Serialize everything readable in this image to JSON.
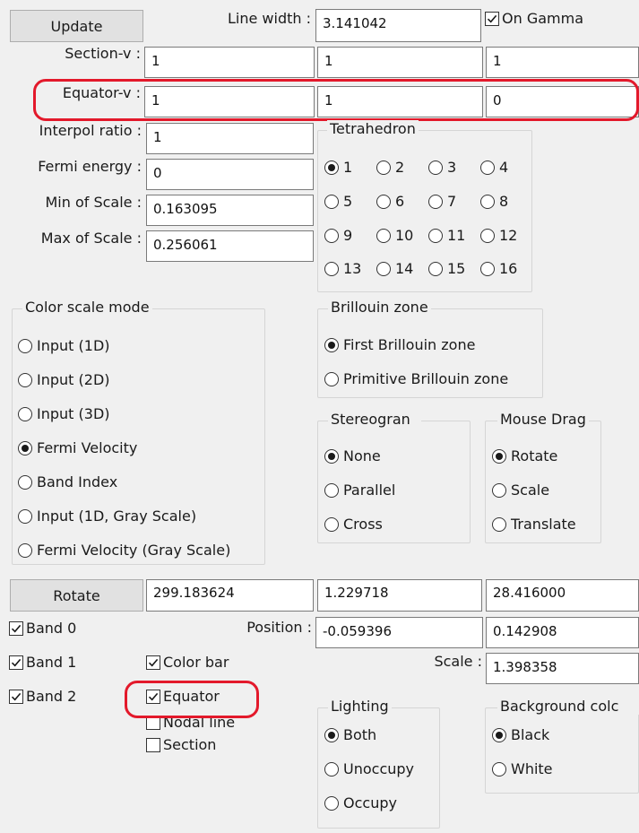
{
  "top": {
    "update_label": "Update",
    "line_width_label": "Line width :",
    "line_width_value": "3.141042",
    "on_gamma_label": "On Gamma",
    "on_gamma_checked": true
  },
  "vectors": {
    "section_label": "Section-v :",
    "section_values": [
      "1",
      "1",
      "1"
    ],
    "equator_label": "Equator-v :",
    "equator_values": [
      "1",
      "1",
      "0"
    ]
  },
  "params": {
    "interpol_label": "Interpol ratio :",
    "interpol_value": "1",
    "fermi_label": "Fermi energy :",
    "fermi_value": "0",
    "min_label": "Min of Scale :",
    "min_value": "0.163095",
    "max_label": "Max of Scale :",
    "max_value": "0.256061"
  },
  "tetrahedron": {
    "title": "Tetrahedron",
    "options": [
      "1",
      "2",
      "3",
      "4",
      "5",
      "6",
      "7",
      "8",
      "9",
      "10",
      "11",
      "12",
      "13",
      "14",
      "15",
      "16"
    ],
    "selected": "1"
  },
  "color_scale": {
    "title": "Color scale mode",
    "options": [
      "Input (1D)",
      "Input (2D)",
      "Input (3D)",
      "Fermi Velocity",
      "Band Index",
      "Input (1D, Gray Scale)",
      "Fermi Velocity (Gray Scale)"
    ],
    "selected": "Fermi Velocity"
  },
  "brillouin": {
    "title": "Brillouin zone",
    "options": [
      "First Brillouin zone",
      "Primitive Brillouin zone"
    ],
    "selected": "First Brillouin zone"
  },
  "stereogram": {
    "title": "Stereogran",
    "options": [
      "None",
      "Parallel",
      "Cross"
    ],
    "selected": "None"
  },
  "mouse_drag": {
    "title": "Mouse Drag",
    "options": [
      "Rotate",
      "Scale",
      "Translate"
    ],
    "selected": "Rotate"
  },
  "rotate": {
    "button_label": "Rotate",
    "values": [
      "299.183624",
      "1.229718",
      "28.416000"
    ]
  },
  "position": {
    "label": "Position :",
    "values": [
      "-0.059396",
      "0.142908"
    ]
  },
  "scale": {
    "label": "Scale :",
    "value": "1.398358"
  },
  "bands": [
    {
      "label": "Band 0",
      "checked": true
    },
    {
      "label": "Band 1",
      "checked": true
    },
    {
      "label": "Band 2",
      "checked": true
    }
  ],
  "display_checks": [
    {
      "label": "Color bar",
      "checked": true
    },
    {
      "label": "Equator",
      "checked": true
    },
    {
      "label": "Nodal line",
      "checked": false
    },
    {
      "label": "Section",
      "checked": false
    }
  ],
  "lighting": {
    "title": "Lighting",
    "options": [
      "Both",
      "Unoccupy",
      "Occupy"
    ],
    "selected": "Both"
  },
  "background": {
    "title": "Background colc",
    "options": [
      "Black",
      "White"
    ],
    "selected": "Black"
  },
  "colors": {
    "highlight": "#e3192b",
    "window_bg": "#f0f0f0",
    "field_border": "#7a7a7a"
  }
}
